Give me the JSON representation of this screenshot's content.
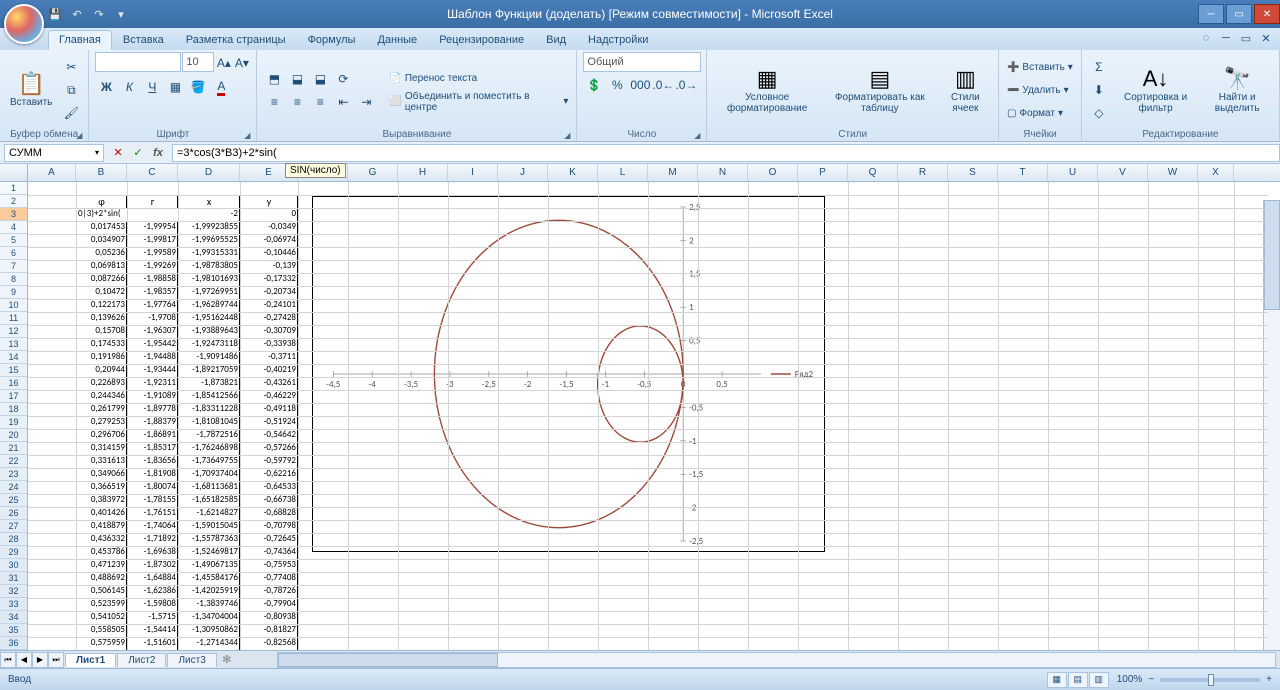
{
  "title": "Шаблон Функции (доделать)  [Режим совместимости] - Microsoft Excel",
  "tabs": [
    "Главная",
    "Вставка",
    "Разметка страницы",
    "Формулы",
    "Данные",
    "Рецензирование",
    "Вид",
    "Надстройки"
  ],
  "groups": {
    "clipboard": "Буфер обмена",
    "font": "Шрифт",
    "align": "Выравнивание",
    "number": "Число",
    "styles": "Стили",
    "cells": "Ячейки",
    "editing": "Редактирование"
  },
  "ribbon": {
    "paste": "Вставить",
    "wrap": "Перенос текста",
    "merge": "Объединить и поместить в центре",
    "number_format": "Общий",
    "cond": "Условное форматирование",
    "astable": "Форматировать как таблицу",
    "cellstyles": "Стили ячеек",
    "insert": "Вставить",
    "delete": "Удалить",
    "format": "Формат",
    "sort": "Сортировка и фильтр",
    "find": "Найти и выделить",
    "font_name": "",
    "font_size": "10"
  },
  "namebox": "СУММ",
  "formula": "=3*cos(3*B3)+2*sin(",
  "tooltip": "SIN(число)",
  "sheets": [
    "Лист1",
    "Лист2",
    "Лист3"
  ],
  "status": "Ввод",
  "zoom": "100%",
  "col_widths": {
    "A": 48,
    "B": 51,
    "C": 51,
    "D": 62,
    "E": 58,
    "F": 50,
    "G": 50,
    "H": 50,
    "I": 50,
    "J": 50,
    "K": 50,
    "L": 50,
    "M": 50,
    "N": 50,
    "O": 50,
    "P": 50,
    "Q": 50,
    "R": 50,
    "S": 50,
    "T": 50,
    "U": 50,
    "V": 50,
    "W": 50,
    "X": 36
  },
  "columns": [
    "A",
    "B",
    "C",
    "D",
    "E",
    "F",
    "G",
    "H",
    "I",
    "J",
    "K",
    "L",
    "M",
    "N",
    "O",
    "P",
    "Q",
    "R",
    "S",
    "T",
    "U",
    "V",
    "W",
    "X"
  ],
  "headers": {
    "phi": "φ",
    "r": "r",
    "x": "x",
    "y": "y"
  },
  "active_cell_display": "0|3)+2*sin(",
  "table": [
    [
      "0,017453",
      "-1,99954",
      "-1,99923855",
      "-0,0349"
    ],
    [
      "0,034907",
      "-1,99817",
      "-1,99695525",
      "-0,06974"
    ],
    [
      "0,05236",
      "-1,99589",
      "-1,99315331",
      "-0,10446"
    ],
    [
      "0,069813",
      "-1,99269",
      "-1,98783805",
      "-0,139"
    ],
    [
      "0,087266",
      "-1,98858",
      "-1,98101693",
      "-0,17332"
    ],
    [
      "0,10472",
      "-1,98357",
      "-1,97269951",
      "-0,20734"
    ],
    [
      "0,122173",
      "-1,97764",
      "-1,96289744",
      "-0,24101"
    ],
    [
      "0,139626",
      "-1,9708",
      "-1,95162448",
      "-0,27428"
    ],
    [
      "0,15708",
      "-1,96307",
      "-1,93889643",
      "-0,30709"
    ],
    [
      "0,174533",
      "-1,95442",
      "-1,92473118",
      "-0,33938"
    ],
    [
      "0,191986",
      "-1,94488",
      "-1,9091486",
      "-0,3711"
    ],
    [
      "0,20944",
      "-1,93444",
      "-1,89217059",
      "-0,40219"
    ],
    [
      "0,226893",
      "-1,92311",
      "-1,873821",
      "-0,43261"
    ],
    [
      "0,244346",
      "-1,91089",
      "-1,85412566",
      "-0,46229"
    ],
    [
      "0,261799",
      "-1,89778",
      "-1,83311228",
      "-0,49118"
    ],
    [
      "0,279253",
      "-1,88379",
      "-1,81081045",
      "-0,51924"
    ],
    [
      "0,296706",
      "-1,86891",
      "-1,7872516",
      "-0,54642"
    ],
    [
      "0,314159",
      "-1,85317",
      "-1,76246898",
      "-0,57266"
    ],
    [
      "0,331613",
      "-1,83656",
      "-1,73649755",
      "-0,59792"
    ],
    [
      "0,349066",
      "-1,81908",
      "-1,70937404",
      "-0,62216"
    ],
    [
      "0,366519",
      "-1,80074",
      "-1,68113681",
      "-0,64533"
    ],
    [
      "0,383972",
      "-1,78155",
      "-1,65182585",
      "-0,66738"
    ],
    [
      "0,401426",
      "-1,76151",
      "-1,6214827",
      "-0,68828"
    ],
    [
      "0,418879",
      "-1,74064",
      "-1,59015045",
      "-0,70798"
    ],
    [
      "0,436332",
      "-1,71892",
      "-1,55787363",
      "-0,72645"
    ],
    [
      "0,453786",
      "-1,69638",
      "-1,52469817",
      "-0,74364"
    ],
    [
      "0,471239",
      "-1,87302",
      "-1,49067135",
      "-0,75953"
    ],
    [
      "0,488692",
      "-1,64884",
      "-1,45584176",
      "-0,77408"
    ],
    [
      "0,506145",
      "-1,62386",
      "-1,42025919",
      "-0,78726"
    ],
    [
      "0,523599",
      "-1,59808",
      "-1,3839746",
      "-0,79904"
    ],
    [
      "0,541052",
      "-1,5715",
      "-1,34704004",
      "-0,80938"
    ],
    [
      "0,558505",
      "-1,54414",
      "-1,30950862",
      "-0,81827"
    ],
    [
      "0,575959",
      "-1,51601",
      "-1,2714344",
      "-0,82568"
    ]
  ],
  "row3_cde": [
    "",
    "-2",
    "0"
  ],
  "chart_data": {
    "type": "line",
    "title": "",
    "series": [
      {
        "name": "Ряд2",
        "color": "#9c4a3a"
      }
    ],
    "xlim": [
      -4.5,
      1
    ],
    "ylim": [
      -2.5,
      2.5
    ],
    "xticks": [
      -4.5,
      -4,
      -3.5,
      -3,
      -2.5,
      -2,
      -1.5,
      -1,
      -0.5,
      0,
      0.5
    ],
    "yticks": [
      -2.5,
      -2,
      -1.5,
      -1,
      -0.5,
      0,
      0.5,
      1,
      1.5,
      2,
      2.5
    ],
    "note": "Polar curve r=3cos(3φ)+2sin(φ) plotted in Cartesian x,y — double loop passing through origin"
  }
}
